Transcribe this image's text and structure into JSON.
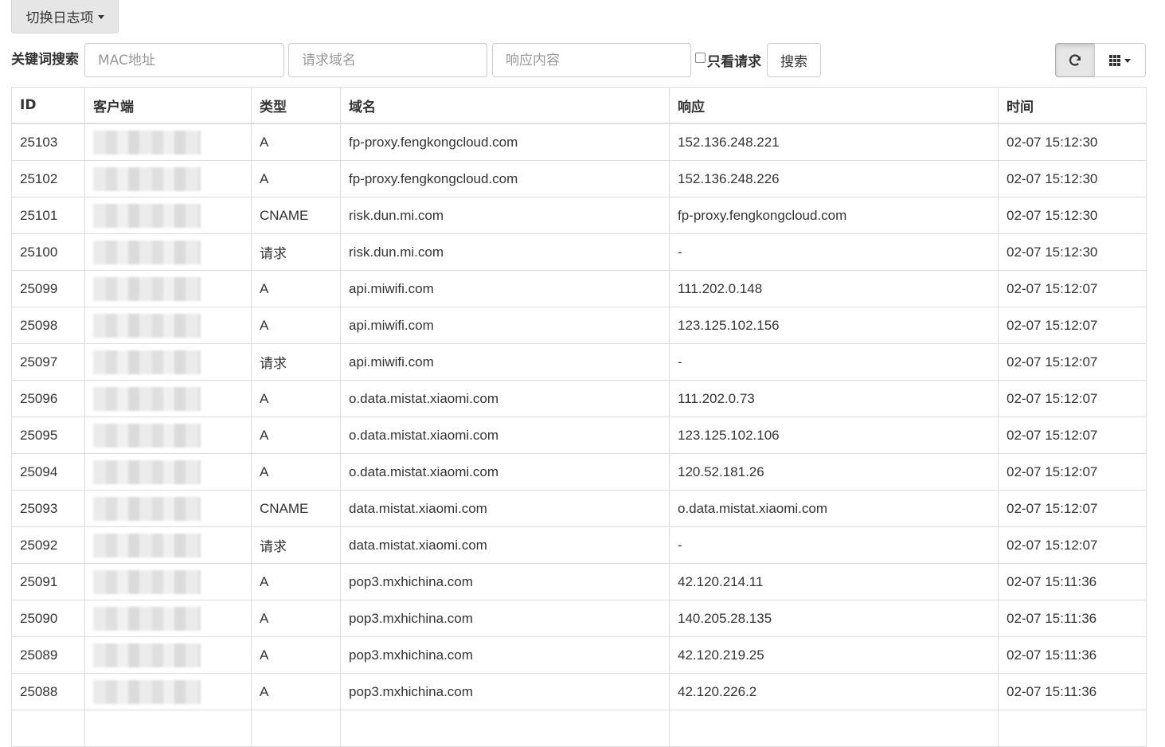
{
  "toolbar": {
    "toggle_label": "切换日志项",
    "keyword_label": "关键词搜索",
    "mac_placeholder": "MAC地址",
    "domain_placeholder": "请求域名",
    "response_placeholder": "响应内容",
    "only_requests_label": "只看请求",
    "search_label": "搜索",
    "refresh_icon": "refresh-icon",
    "columns_icon": "grid-icon"
  },
  "table": {
    "headers": [
      "ID",
      "客户端",
      "类型",
      "域名",
      "响应",
      "时间"
    ],
    "rows": [
      {
        "id": "25103",
        "type": "A",
        "domain": "fp-proxy.fengkongcloud.com",
        "response": "152.136.248.221",
        "time": "02-07 15:12:30"
      },
      {
        "id": "25102",
        "type": "A",
        "domain": "fp-proxy.fengkongcloud.com",
        "response": "152.136.248.226",
        "time": "02-07 15:12:30"
      },
      {
        "id": "25101",
        "type": "CNAME",
        "domain": "risk.dun.mi.com",
        "response": "fp-proxy.fengkongcloud.com",
        "time": "02-07 15:12:30"
      },
      {
        "id": "25100",
        "type": "请求",
        "domain": "risk.dun.mi.com",
        "response": "-",
        "time": "02-07 15:12:30"
      },
      {
        "id": "25099",
        "type": "A",
        "domain": "api.miwifi.com",
        "response": "111.202.0.148",
        "time": "02-07 15:12:07"
      },
      {
        "id": "25098",
        "type": "A",
        "domain": "api.miwifi.com",
        "response": "123.125.102.156",
        "time": "02-07 15:12:07"
      },
      {
        "id": "25097",
        "type": "请求",
        "domain": "api.miwifi.com",
        "response": "-",
        "time": "02-07 15:12:07"
      },
      {
        "id": "25096",
        "type": "A",
        "domain": "o.data.mistat.xiaomi.com",
        "response": "111.202.0.73",
        "time": "02-07 15:12:07"
      },
      {
        "id": "25095",
        "type": "A",
        "domain": "o.data.mistat.xiaomi.com",
        "response": "123.125.102.106",
        "time": "02-07 15:12:07"
      },
      {
        "id": "25094",
        "type": "A",
        "domain": "o.data.mistat.xiaomi.com",
        "response": "120.52.181.26",
        "time": "02-07 15:12:07"
      },
      {
        "id": "25093",
        "type": "CNAME",
        "domain": "data.mistat.xiaomi.com",
        "response": "o.data.mistat.xiaomi.com",
        "time": "02-07 15:12:07"
      },
      {
        "id": "25092",
        "type": "请求",
        "domain": "data.mistat.xiaomi.com",
        "response": "-",
        "time": "02-07 15:12:07"
      },
      {
        "id": "25091",
        "type": "A",
        "domain": "pop3.mxhichina.com",
        "response": "42.120.214.11",
        "time": "02-07 15:11:36"
      },
      {
        "id": "25090",
        "type": "A",
        "domain": "pop3.mxhichina.com",
        "response": "140.205.28.135",
        "time": "02-07 15:11:36"
      },
      {
        "id": "25089",
        "type": "A",
        "domain": "pop3.mxhichina.com",
        "response": "42.120.219.25",
        "time": "02-07 15:11:36"
      },
      {
        "id": "25088",
        "type": "A",
        "domain": "pop3.mxhichina.com",
        "response": "42.120.226.2",
        "time": "02-07 15:11:36"
      },
      {
        "id": "",
        "type": "",
        "domain": "",
        "response": "",
        "time": ""
      }
    ]
  }
}
